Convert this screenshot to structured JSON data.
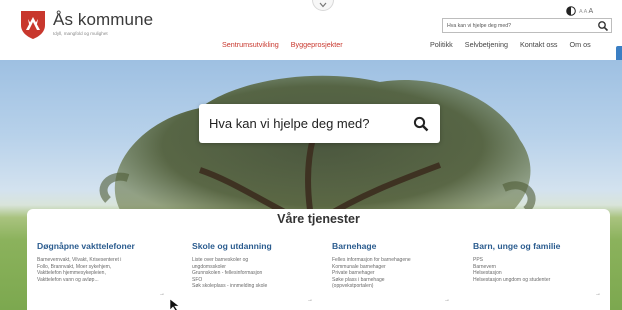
{
  "header": {
    "brand_name": "Ås kommune",
    "brand_tagline": "Idyll, mangfold og mulighet",
    "search_value": "Hva kan vi hjelpe deg med?",
    "text_size_label": "A A",
    "text_size_big": "A",
    "nav_highlight": [
      {
        "label": "Sentrumsutvikling"
      },
      {
        "label": "Byggeprosjekter"
      }
    ],
    "nav_main": [
      {
        "label": "Politikk"
      },
      {
        "label": "Selvbetjening"
      },
      {
        "label": "Kontakt oss"
      },
      {
        "label": "Om os"
      }
    ]
  },
  "hero": {
    "search_placeholder": "Hva kan vi hjelpe deg med?"
  },
  "services": {
    "title": "Våre tjenester",
    "columns": [
      {
        "heading": "Døgnåpne vakttelefoner",
        "links": [
          "Barnevernvakt, Vilvakt, Krisesenteret i",
          "Follo, Brannvakt, Moer sykehjem,",
          "Vakttelefon hjemmesykepleien,",
          "Vakttelefon vann og avløp..."
        ],
        "arrow": "→"
      },
      {
        "heading": "Skole og utdanning",
        "links": [
          "Liste over barneskoler og",
          "ungdomsskoler",
          "Grunnskolen - fellesinformasjon",
          "SFO",
          "Søk skoleplass - innmelding skole"
        ],
        "arrow": "→"
      },
      {
        "heading": "Barnehage",
        "links": [
          "Felles informasjon for barnehagene",
          "Kommunale barnehager",
          "Private barnehager",
          "Søke plass i barnehage",
          "(oppvekstportalen)"
        ],
        "arrow": "→"
      },
      {
        "heading": "Barn, unge og familie",
        "links": [
          "PPS",
          "Barnevern",
          "Helsestasjon",
          "Helsestasjon ungdom og studenter"
        ],
        "arrow": "→"
      }
    ]
  },
  "colors": {
    "brand_red": "#c8372d",
    "heading_blue": "#2b5c8f"
  }
}
